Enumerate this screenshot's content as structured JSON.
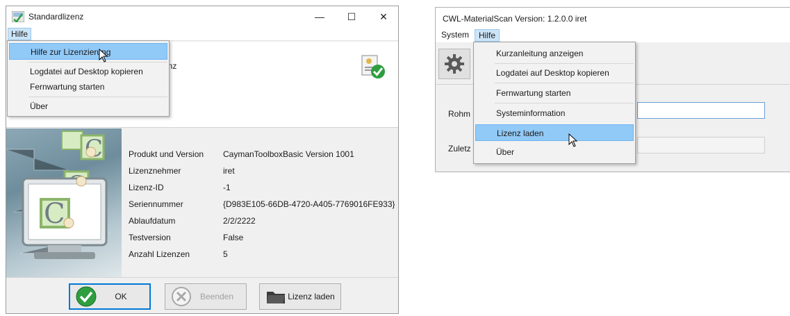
{
  "left_window": {
    "title": "Standardlizenz",
    "controls": {
      "minimize": "—",
      "maximize": "☐",
      "close": "✕"
    },
    "menu": {
      "hilfe": "Hilfe"
    },
    "banner_partial_text": "enz",
    "dropdown": {
      "items": [
        {
          "label": "Hilfe zur Lizenzierung",
          "highlighted": true
        },
        {
          "label": "Logdatei auf Desktop kopieren",
          "highlighted": false
        },
        {
          "label": "Fernwartung starten",
          "highlighted": false
        },
        {
          "label": "Über",
          "highlighted": false
        }
      ]
    },
    "info": [
      {
        "label": "Produkt und Version",
        "value": "CaymanToolboxBasic   Version 1001"
      },
      {
        "label": "Lizenznehmer",
        "value": "iret"
      },
      {
        "label": "Lizenz-ID",
        "value": "-1"
      },
      {
        "label": "Seriennummer",
        "value": "{D983E105-66DB-4720-A405-7769016FE933}"
      },
      {
        "label": "Ablaufdatum",
        "value": "2/2/2222"
      },
      {
        "label": "Testversion",
        "value": "False"
      },
      {
        "label": "Anzahl Lizenzen",
        "value": "5"
      }
    ],
    "buttons": {
      "ok": "OK",
      "beenden": "Beenden",
      "lizenz_laden": "Lizenz laden"
    },
    "colors": {
      "accent": "#0078d7",
      "check_green": "#2e9e3f",
      "highlight": "#91c9f7"
    }
  },
  "right_window": {
    "title": "CWL-MaterialScan  Version: 1.2.0.0  iret",
    "menu": {
      "system": "System",
      "hilfe": "Hilfe"
    },
    "dropdown": {
      "items": [
        {
          "label": "Kurzanleitung anzeigen",
          "highlighted": false
        },
        {
          "label": "Logdatei auf Desktop kopieren",
          "highlighted": false
        },
        {
          "label": "Fernwartung starten",
          "highlighted": false
        },
        {
          "label": "Systeminformation",
          "highlighted": false
        },
        {
          "label": "Lizenz laden",
          "highlighted": true
        },
        {
          "label": "Über",
          "highlighted": false
        }
      ]
    },
    "rows": [
      {
        "label": "Rohm"
      },
      {
        "label": "Zuletz"
      }
    ]
  }
}
